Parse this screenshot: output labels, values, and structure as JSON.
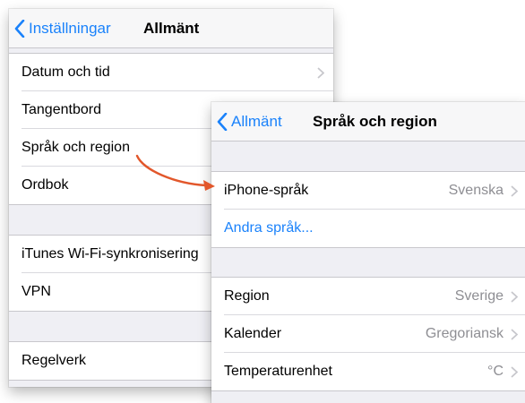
{
  "back_panel": {
    "nav": {
      "back_label": "Inställningar",
      "title": "Allmänt"
    },
    "rows": [
      "Datum och tid",
      "Tangentbord",
      "Språk och region",
      "Ordbok",
      "iTunes Wi-Fi-synkronisering",
      "VPN",
      "Regelverk"
    ]
  },
  "front_panel": {
    "nav": {
      "back_label": "Allmänt",
      "title": "Språk och region"
    },
    "iphone_language": {
      "label": "iPhone-språk",
      "value": "Svenska"
    },
    "other_languages": "Andra språk...",
    "region": {
      "label": "Region",
      "value": "Sverige"
    },
    "calendar": {
      "label": "Kalender",
      "value": "Gregoriansk"
    },
    "temperature": {
      "label": "Temperaturenhet",
      "value": "°C"
    }
  },
  "colors": {
    "accent": "#1a82fb",
    "annotation_arrow": "#e2572b",
    "grouped_background": "#efeff4"
  }
}
